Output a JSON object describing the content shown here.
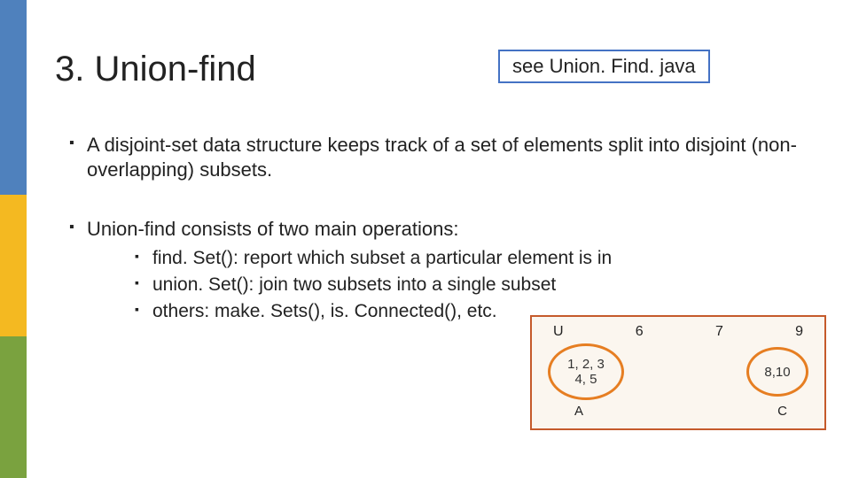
{
  "title": "3.  Union-find",
  "see_box": "see Union. Find. java",
  "bullets": {
    "b1": "A disjoint-set data structure keeps track of a set of elements split into disjoint (non-overlapping) subsets.",
    "b2": "Union-find consists of two main operations:",
    "sub": {
      "s1": "find. Set(): report which subset a particular element is in",
      "s2": "union. Set(): join two subsets into a single subset",
      "s3": "others: make. Sets(), is. Connected(), etc."
    }
  },
  "diagram": {
    "top": {
      "u": "U",
      "n6": "6",
      "n7": "7",
      "n9": "9"
    },
    "circle_a_line1": "1, 2, 3",
    "circle_a_line2": "4, 5",
    "circle_c": "8,10",
    "label_a": "A",
    "label_c": "C"
  }
}
